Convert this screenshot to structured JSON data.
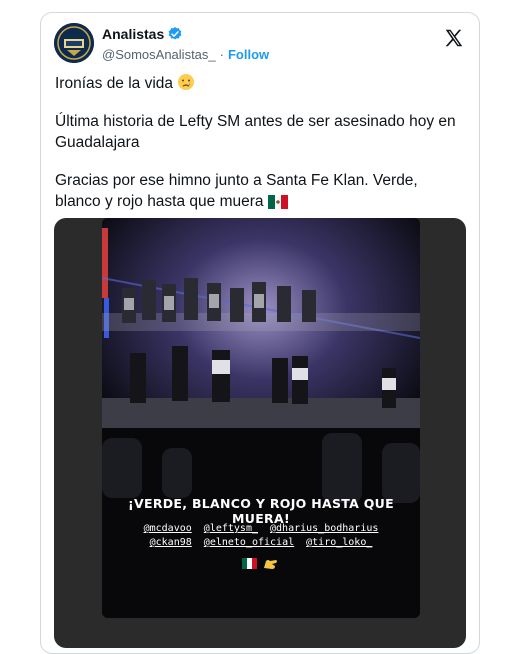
{
  "author": {
    "name": "Analistas",
    "handle": "@SomosAnalistas_",
    "separator": "·",
    "follow_label": "Follow"
  },
  "tweet": {
    "line1": "Ironías de la vida",
    "line2": "Última historia de Lefty SM antes de ser asesinado hoy en Guadalajara",
    "line3": "Gracias por ese himno junto a Santa Fe Klan. Verde, blanco y rojo hasta que muera"
  },
  "story": {
    "title": "¡VERDE, BLANCO Y ROJO HASTA QUE MUERA!",
    "tags_row1": [
      "@mcdavoo",
      "@leftysm_",
      "@dharius_bodharius"
    ],
    "tags_row2": [
      "@ckan98",
      "@elneto_oficial",
      "@tiro_loko_"
    ]
  },
  "colors": {
    "accent": "#1d9bf0",
    "text": "#0f1419",
    "secondary": "#536471",
    "border": "#cfd9de"
  },
  "icons": [
    "verified-badge-icon",
    "x-logo-icon",
    "crying-face-emoji",
    "mexico-flag-emoji",
    "hand-emoji"
  ]
}
